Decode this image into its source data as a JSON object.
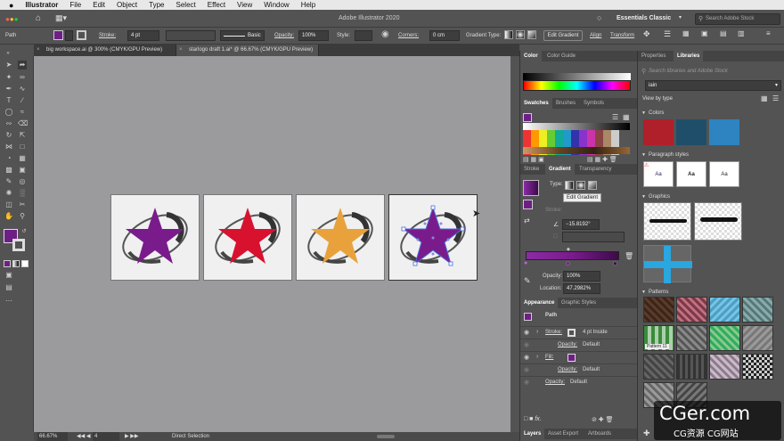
{
  "menubar": {
    "apple": "",
    "app": "Illustrator",
    "items": [
      "File",
      "Edit",
      "Object",
      "Type",
      "Select",
      "Effect",
      "View",
      "Window",
      "Help"
    ]
  },
  "appbar": {
    "title": "Adobe Illustrator 2020",
    "workspace": "Essentials Classic",
    "search_placeholder": "Search Adobe Stock"
  },
  "control": {
    "selection": "Path",
    "stroke_label": "Stroke:",
    "stroke_value": "4 pt",
    "brush": "Basic",
    "opacity_label": "Opacity:",
    "opacity_value": "100%",
    "style_label": "Style:",
    "corners_label": "Corners:",
    "corners_value": "0 cm",
    "gradient_type_label": "Gradient Type:",
    "edit_gradient": "Edit Gradient",
    "align": "Align",
    "transform": "Transform"
  },
  "documents": [
    {
      "label": "big workspace.ai @ 300% (CMYK/GPU Preview)"
    },
    {
      "label": "starlogo draft 1.ai* @ 66.67% (CMYK/GPU Preview)"
    }
  ],
  "artboards": [
    {
      "star_color": "#7a1b8c",
      "selected": false
    },
    {
      "star_color": "#d8112f",
      "selected": false
    },
    {
      "star_color": "#e9a23b",
      "selected": false
    },
    {
      "star_color": "#7a1b8c",
      "selected": true
    }
  ],
  "color_panel": {
    "tabs": [
      "Color",
      "Color Guide"
    ]
  },
  "swatches_panel": {
    "tabs": [
      "Swatches",
      "Brushes",
      "Symbols"
    ]
  },
  "gradient_panel": {
    "tabs": [
      "Stroke",
      "Gradient",
      "Transparency"
    ],
    "type_label": "Type:",
    "tooltip": "Edit Gradient",
    "stroke_label": "Stroke:",
    "angle": "−15.8192°",
    "opacity_label": "Opacity:",
    "opacity_value": "100%",
    "location_label": "Location:",
    "location_value": "47.2982%"
  },
  "appearance_panel": {
    "tabs": [
      "Appearance",
      "Graphic Styles"
    ],
    "title": "Path",
    "rows": [
      {
        "label": "Stroke:",
        "value": "4 pt  Inside"
      },
      {
        "label": "Opacity:",
        "value": "Default"
      },
      {
        "label": "Fill:",
        "value": ""
      },
      {
        "label": "Opacity:",
        "value": "Default"
      },
      {
        "label": "Opacity:",
        "value": "Default"
      }
    ]
  },
  "layers_panel": {
    "tabs": [
      "Layers",
      "Asset Export",
      "Artboards"
    ]
  },
  "libraries": {
    "tabs": [
      "Properties",
      "Libraries"
    ],
    "search_placeholder": "Search libraries and Adobe Stock",
    "selected_library": "iain",
    "view_by": "View by type",
    "sections": {
      "colors": "Colors",
      "paragraph_styles": "Paragraph styles",
      "graphics": "Graphics",
      "patterns": "Patterns"
    },
    "colors": [
      "#b0202a",
      "#1f4e6b",
      "#2d84c1"
    ],
    "para_label": "Aa",
    "pattern_tooltip": "Pattern 11"
  },
  "status": {
    "zoom": "66.67%",
    "artboard_no": "4",
    "tool": "Direct Selection"
  },
  "watermark": {
    "line1": "CGer.com",
    "line2": "CG资源 CG网站"
  }
}
